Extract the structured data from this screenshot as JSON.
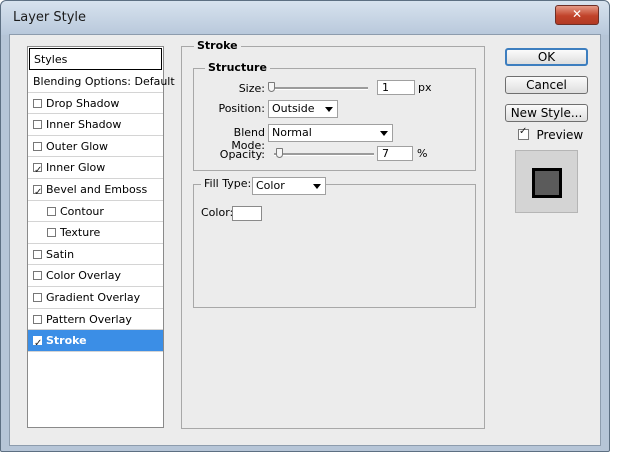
{
  "window": {
    "title": "Layer Style",
    "close_glyph": "✕"
  },
  "styles_list": {
    "header": "Styles",
    "items": [
      {
        "label": "Blending Options: Default",
        "checkbox": false,
        "checked": false,
        "selected": false,
        "sub": false
      },
      {
        "label": "Drop Shadow",
        "checkbox": true,
        "checked": false,
        "selected": false,
        "sub": false
      },
      {
        "label": "Inner Shadow",
        "checkbox": true,
        "checked": false,
        "selected": false,
        "sub": false
      },
      {
        "label": "Outer Glow",
        "checkbox": true,
        "checked": false,
        "selected": false,
        "sub": false
      },
      {
        "label": "Inner Glow",
        "checkbox": true,
        "checked": true,
        "selected": false,
        "sub": false
      },
      {
        "label": "Bevel and Emboss",
        "checkbox": true,
        "checked": true,
        "selected": false,
        "sub": false
      },
      {
        "label": "Contour",
        "checkbox": true,
        "checked": false,
        "selected": false,
        "sub": true
      },
      {
        "label": "Texture",
        "checkbox": true,
        "checked": false,
        "selected": false,
        "sub": true
      },
      {
        "label": "Satin",
        "checkbox": true,
        "checked": false,
        "selected": false,
        "sub": false
      },
      {
        "label": "Color Overlay",
        "checkbox": true,
        "checked": false,
        "selected": false,
        "sub": false
      },
      {
        "label": "Gradient Overlay",
        "checkbox": true,
        "checked": false,
        "selected": false,
        "sub": false
      },
      {
        "label": "Pattern Overlay",
        "checkbox": true,
        "checked": false,
        "selected": false,
        "sub": false
      },
      {
        "label": "Stroke",
        "checkbox": true,
        "checked": true,
        "selected": true,
        "sub": false
      }
    ]
  },
  "stroke": {
    "section_title": "Stroke",
    "structure_title": "Structure",
    "size_label": "Size:",
    "size_value": "1",
    "size_unit": "px",
    "position_label": "Position:",
    "position_value": "Outside",
    "blend_mode_label": "Blend Mode:",
    "blend_mode_value": "Normal",
    "opacity_label": "Opacity:",
    "opacity_value": "7",
    "opacity_unit": "%",
    "fill_type_label": "Fill Type:",
    "fill_type_value": "Color",
    "color_label": "Color:",
    "color_value": "#ffffff"
  },
  "buttons": {
    "ok": "OK",
    "cancel": "Cancel",
    "new_style": "New Style..."
  },
  "preview": {
    "label": "Preview",
    "checked": true
  },
  "colors": {
    "selection": "#3b8ee6",
    "default_button_border": "#3d7ebf",
    "close_button": "#c1432a"
  }
}
